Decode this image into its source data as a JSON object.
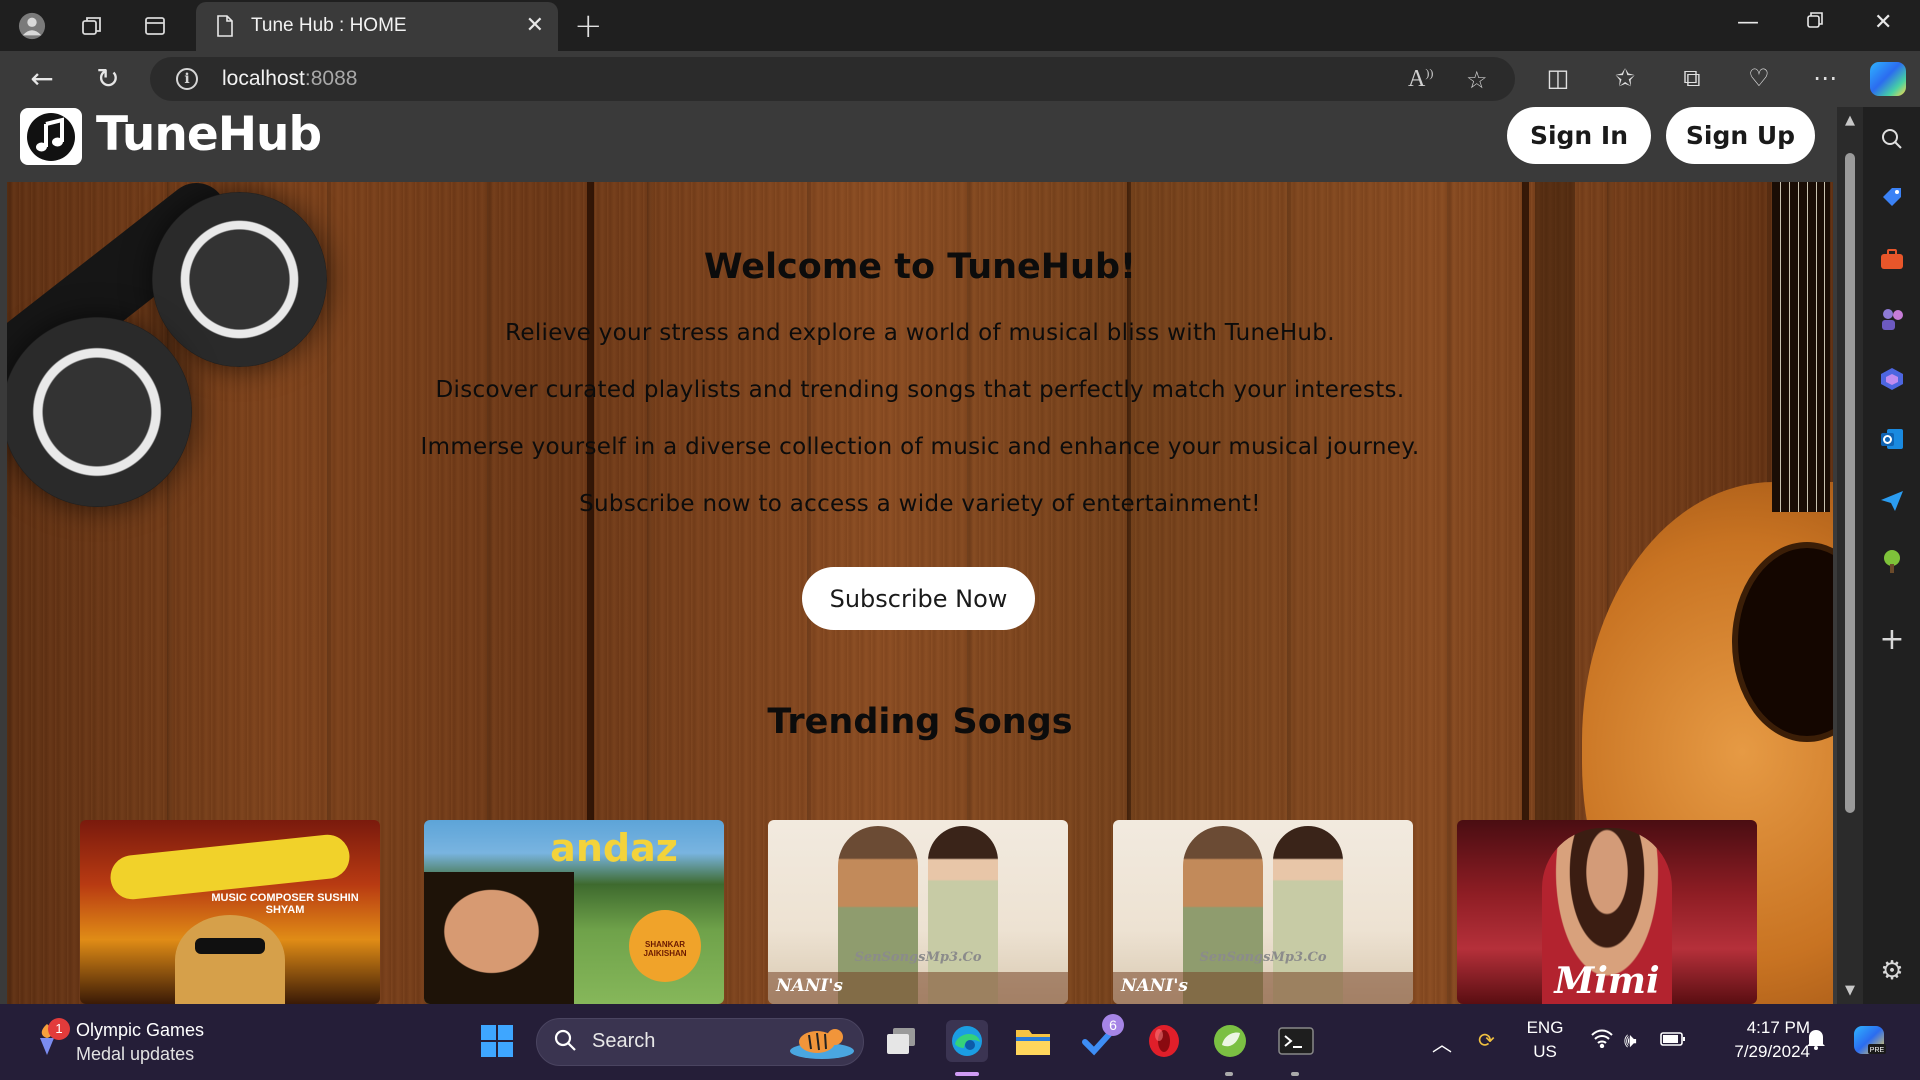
{
  "browser": {
    "tab_title": "Tune Hub : HOME",
    "url_host": "localhost",
    "url_port": ":8088"
  },
  "site": {
    "brand": "TuneHub",
    "sign_in": "Sign In",
    "sign_up": "Sign Up"
  },
  "hero": {
    "title": "Welcome to TuneHub!",
    "lines": [
      "Relieve your stress and explore a world of musical bliss with TuneHub.",
      "Discover curated playlists and trending songs that perfectly match your interests.",
      "Immerse yourself in a diverse collection of music and enhance your musical journey.",
      "Subscribe now to access a wide variety of entertainment!"
    ],
    "subscribe_label": "Subscribe Now",
    "trending_title": "Trending Songs"
  },
  "trending_cards": [
    {
      "art": "aavesham-cover",
      "caption": "",
      "credit": "MUSIC COMPOSER SUSHIN SHYAM"
    },
    {
      "art": "andaz-cover",
      "caption": "andaz",
      "credit": "SHANKAR JAIKISHAN"
    },
    {
      "art": "nani-cover",
      "caption": "NANI's",
      "credit": "SenSongsMp3.Co"
    },
    {
      "art": "nani-cover",
      "caption": "NANI's",
      "credit": "SenSongsMp3.Co"
    },
    {
      "art": "mimi-cover",
      "caption": "Mimi",
      "credit": ""
    }
  ],
  "taskbar": {
    "weather_title": "Olympic Games",
    "weather_sub": "Medal updates",
    "weather_badge": "1",
    "search_label": "Search",
    "todo_badge": "6",
    "lang_top": "ENG",
    "lang_bottom": "US",
    "time": "4:17 PM",
    "date": "7/29/2024"
  },
  "colors": {
    "chrome_dark": "#1f1f1f",
    "chrome_tab": "#3a3a3a",
    "taskbar": "#251e38",
    "wood": "#7e421b"
  }
}
